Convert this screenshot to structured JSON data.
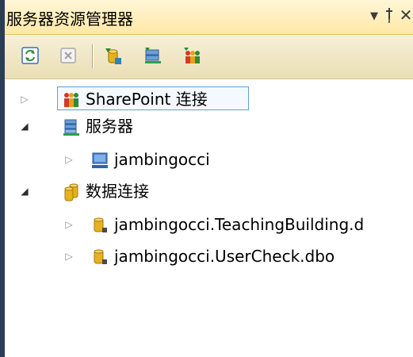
{
  "window": {
    "title": "服务器资源管理器",
    "dropdown_glyph": "▼",
    "pin_glyph": "ꝓ",
    "close_glyph": "✕"
  },
  "toolbar": {
    "buttons": [
      {
        "name": "refresh",
        "icon": "refresh-icon"
      },
      {
        "name": "stop-refresh",
        "icon": "stop-icon"
      },
      {
        "name": "connect-to-database",
        "icon": "connect-database-icon"
      },
      {
        "name": "connect-to-server",
        "icon": "connect-server-icon"
      },
      {
        "name": "connect-to-sharepoint",
        "icon": "connect-sharepoint-icon"
      }
    ]
  },
  "tree": {
    "nodes": [
      {
        "label": "SharePoint 连接",
        "state": "collapsed",
        "level": 0,
        "icon": "sharepoint-icon",
        "selected": true
      },
      {
        "label": "服务器",
        "state": "expanded",
        "level": 0,
        "icon": "servers-icon",
        "selected": false
      },
      {
        "label": "jambingocci",
        "state": "collapsed",
        "level": 1,
        "icon": "computer-icon",
        "selected": false
      },
      {
        "label": "数据连接",
        "state": "expanded",
        "level": 0,
        "icon": "data-connections-icon",
        "selected": false
      },
      {
        "label": "jambingocci.TeachingBuilding.d",
        "state": "collapsed",
        "level": 1,
        "icon": "database-connection-icon",
        "selected": false
      },
      {
        "label": "jambingocci.UserCheck.dbo",
        "state": "collapsed",
        "level": 1,
        "icon": "database-connection-icon",
        "selected": false
      }
    ]
  },
  "colors": {
    "title_bar": "#ffe8a6",
    "toolbar": "#e9deb5",
    "selection_border": "#5c9fdd",
    "left_edge": "#2b3c59"
  }
}
